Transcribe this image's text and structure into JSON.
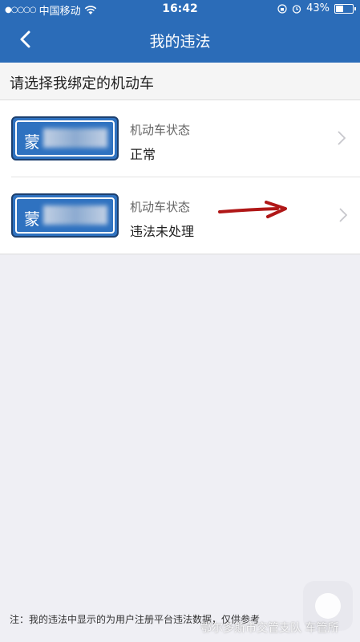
{
  "status_bar": {
    "signal_dots": "●○○○○",
    "carrier": "中国移动",
    "wifi_icon": "wifi-icon",
    "time": "16:42",
    "battery_percent": "43%",
    "battery_level": 0.43
  },
  "nav": {
    "title": "我的违法",
    "back_icon": "chevron-left-icon"
  },
  "section": {
    "title": "请选择我绑定的机动车"
  },
  "vehicles": [
    {
      "plate_prefix": "蒙",
      "status_label": "机动车状态",
      "status_value": "正常"
    },
    {
      "plate_prefix": "蒙",
      "status_label": "机动车状态",
      "status_value": "违法未处理"
    }
  ],
  "footer": {
    "note": "注：我的违法中显示的为用户注册平台违法数据，仅供参考"
  },
  "watermark": {
    "text": "鄂尔多斯市交管支队 车管所"
  },
  "colors": {
    "nav_bg": "#2b6cb8",
    "plate_bg": "#2f72c0",
    "annotation_arrow": "#b01717"
  }
}
